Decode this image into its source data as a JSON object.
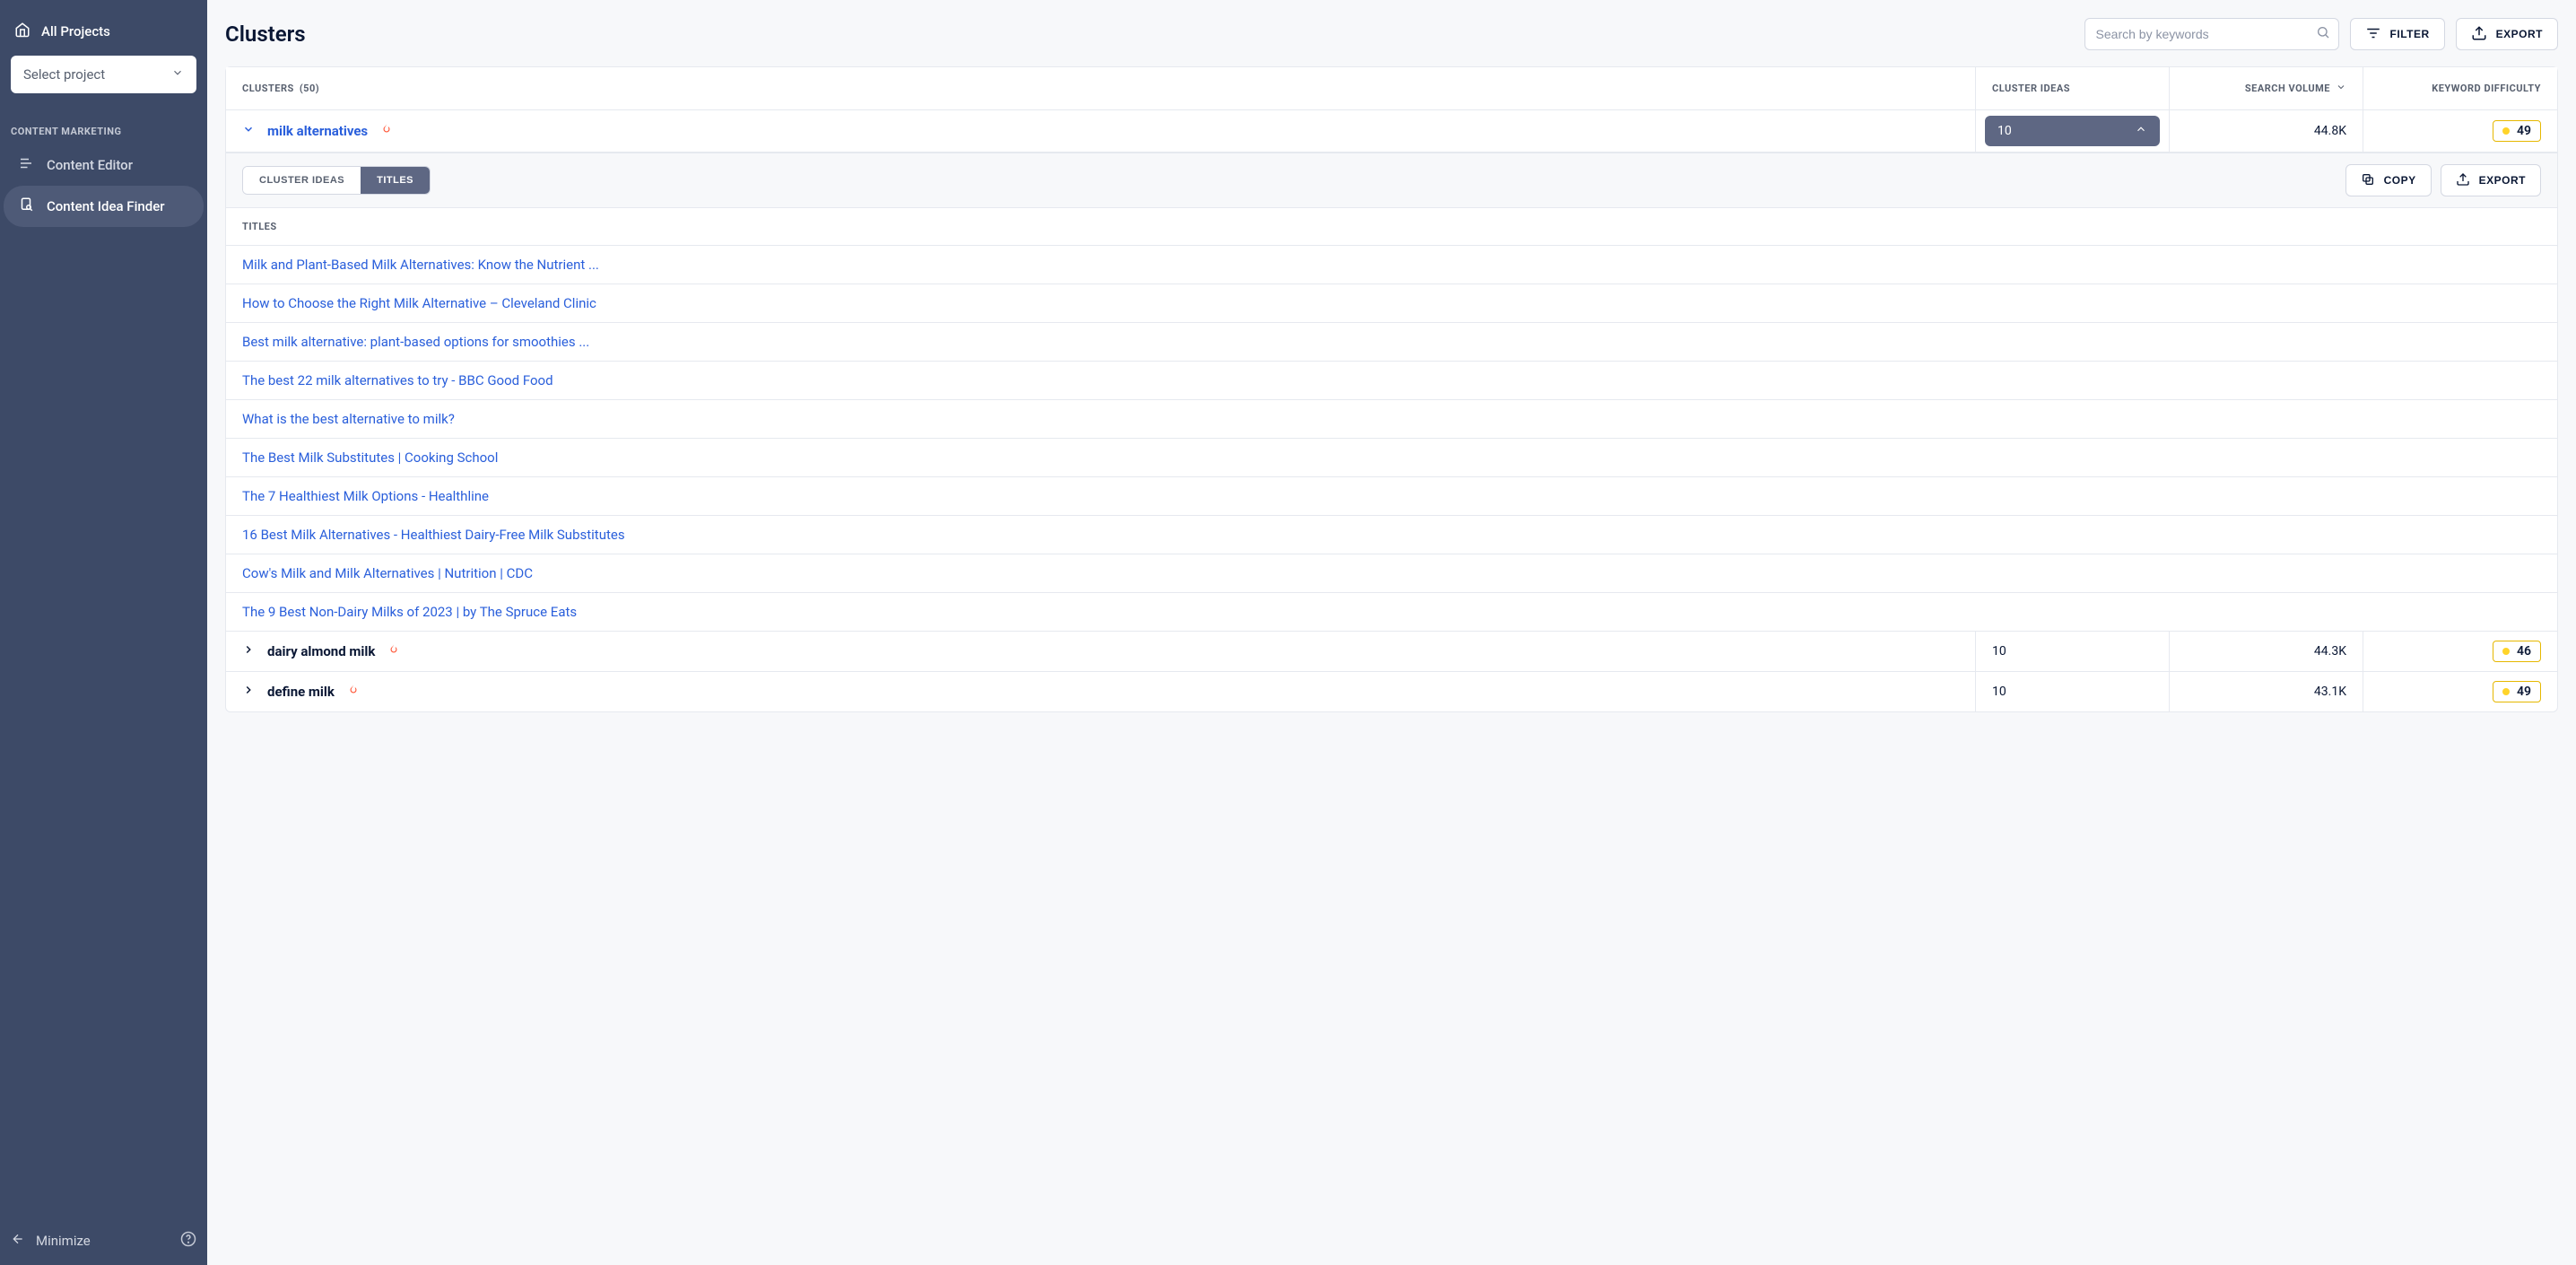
{
  "sidebar": {
    "all_projects_label": "All Projects",
    "project_select_placeholder": "Select project",
    "section_label": "CONTENT MARKETING",
    "items": [
      {
        "label": "Content Editor",
        "active": false
      },
      {
        "label": "Content Idea Finder",
        "active": true
      }
    ],
    "minimize_label": "Minimize"
  },
  "header": {
    "title": "Clusters",
    "search_placeholder": "Search by keywords",
    "filter_label": "FILTER",
    "export_label": "EXPORT"
  },
  "table": {
    "columns": {
      "clusters": "CLUSTERS",
      "clusters_count": "(50)",
      "cluster_ideas": "CLUSTER IDEAS",
      "search_volume": "SEARCH VOLUME",
      "keyword_difficulty": "KEYWORD DIFFICULTY"
    },
    "rows": [
      {
        "name": "milk alternatives",
        "trending": true,
        "expanded": true,
        "ideas": "10",
        "volume": "44.8K",
        "kd": "49"
      },
      {
        "name": "dairy almond milk",
        "trending": true,
        "expanded": false,
        "ideas": "10",
        "volume": "44.3K",
        "kd": "46"
      },
      {
        "name": "define milk",
        "trending": true,
        "expanded": false,
        "ideas": "10",
        "volume": "43.1K",
        "kd": "49"
      }
    ]
  },
  "expanded_panel": {
    "tabs": {
      "cluster_ideas": "CLUSTER IDEAS",
      "titles": "TITLES"
    },
    "copy_label": "COPY",
    "export_label": "EXPORT",
    "titles_header": "TITLES",
    "titles": [
      "Milk and Plant-Based Milk Alternatives: Know the Nutrient ...",
      "How to Choose the Right Milk Alternative – Cleveland Clinic",
      "Best milk alternative: plant-based options for smoothies ...",
      "The best 22 milk alternatives to try - BBC Good Food",
      "What is the best alternative to milk?",
      "The Best Milk Substitutes | Cooking School",
      "The 7 Healthiest Milk Options - Healthline",
      "16 Best Milk Alternatives - Healthiest Dairy-Free Milk Substitutes",
      "Cow's Milk and Milk Alternatives | Nutrition | CDC",
      "The 9 Best Non-Dairy Milks of 2023 | by The Spruce Eats"
    ]
  }
}
